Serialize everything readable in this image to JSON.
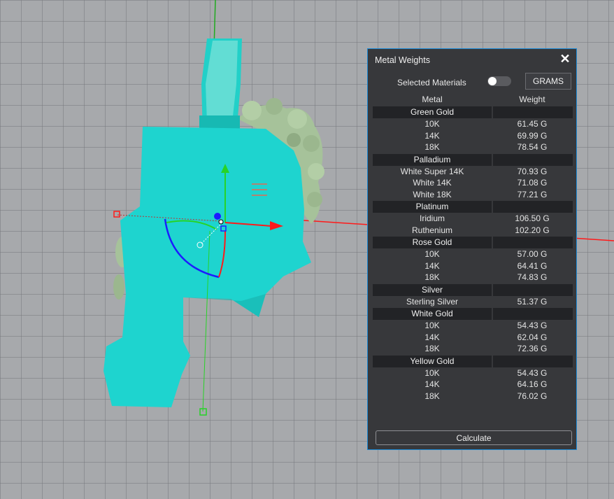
{
  "colors": {
    "model": "#1ed4cf",
    "stones": "#a6c29a",
    "axis_x": "#ff1a1a",
    "axis_y": "#27d327",
    "axis_z": "#1c1cff",
    "panel_bg": "#37383b",
    "panel_border": "#1c8ad6",
    "group_bg": "#222326"
  },
  "panel": {
    "title": "Metal Weights",
    "close_icon": "close-icon",
    "selected_materials_label": "Selected Materials",
    "toggle_on": false,
    "units_button": "GRAMS",
    "columns": {
      "metal": "Metal",
      "weight": "Weight"
    },
    "groups": [
      {
        "name": "Green Gold",
        "rows": [
          {
            "metal": "10K",
            "weight": "61.45 G"
          },
          {
            "metal": "14K",
            "weight": "69.99 G"
          },
          {
            "metal": "18K",
            "weight": "78.54 G"
          }
        ]
      },
      {
        "name": "Palladium",
        "rows": [
          {
            "metal": "White Super 14K",
            "weight": "70.93 G"
          },
          {
            "metal": "White 14K",
            "weight": "71.08 G"
          },
          {
            "metal": "White 18K",
            "weight": "77.21 G"
          }
        ]
      },
      {
        "name": "Platinum",
        "rows": [
          {
            "metal": "Iridium",
            "weight": "106.50 G"
          },
          {
            "metal": "Ruthenium",
            "weight": "102.20 G"
          }
        ]
      },
      {
        "name": "Rose Gold",
        "rows": [
          {
            "metal": "10K",
            "weight": "57.00 G"
          },
          {
            "metal": "14K",
            "weight": "64.41 G"
          },
          {
            "metal": "18K",
            "weight": "74.83 G"
          }
        ]
      },
      {
        "name": "Silver",
        "rows": [
          {
            "metal": "Sterling Silver",
            "weight": "51.37 G"
          }
        ]
      },
      {
        "name": "White Gold",
        "rows": [
          {
            "metal": "10K",
            "weight": "54.43 G"
          },
          {
            "metal": "14K",
            "weight": "62.04 G"
          },
          {
            "metal": "18K",
            "weight": "72.36 G"
          }
        ]
      },
      {
        "name": "Yellow Gold",
        "rows": [
          {
            "metal": "10K",
            "weight": "54.43 G"
          },
          {
            "metal": "14K",
            "weight": "64.16 G"
          },
          {
            "metal": "18K",
            "weight": "76.02 G"
          }
        ]
      }
    ],
    "calculate_button": "Calculate"
  }
}
